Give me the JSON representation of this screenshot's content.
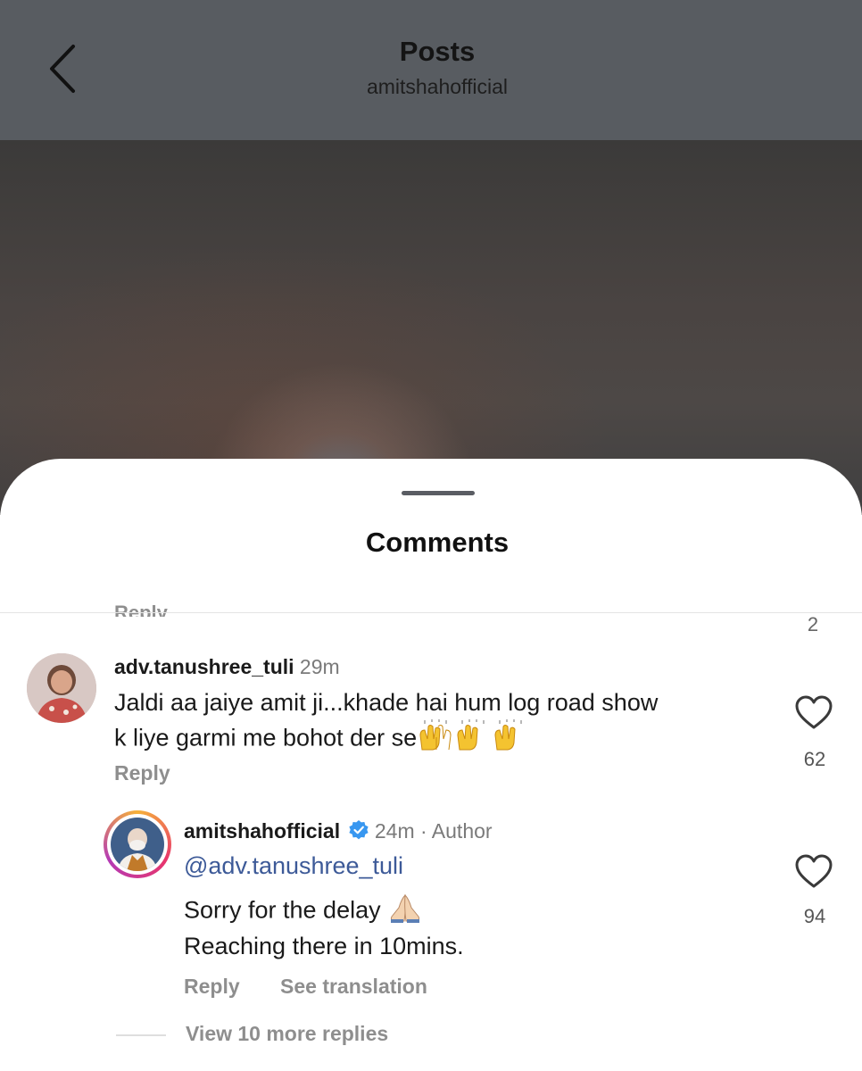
{
  "header": {
    "title": "Posts",
    "subtitle": "amitshahofficial",
    "back_icon": "chevron-left-icon"
  },
  "sheet": {
    "title": "Comments",
    "cut_off_reply_label": "Reply",
    "prev_like_count": "2"
  },
  "comments": [
    {
      "username": "adv.tanushree_tuli",
      "time": "29m",
      "lines": [
        "Jaldi aa jaiye amit ji...khade hai hum log road show",
        "k liye garmi me bohot der se"
      ],
      "emoji": "raising-hands-icon",
      "reply_label": "Reply",
      "like_count": "62"
    }
  ],
  "reply": {
    "username": "amitshahofficial",
    "verified_icon": "verified-badge-icon",
    "time_meta": "24m · Author",
    "mention": "@adv.tanushree_tuli",
    "line1": "Sorry for the delay",
    "line1_emoji": "folded-hands-icon",
    "line2": "Reaching there in 10mins.",
    "reply_label": "Reply",
    "translate_label": "See translation",
    "like_count": "94"
  },
  "view_more_replies": "View 10 more replies"
}
